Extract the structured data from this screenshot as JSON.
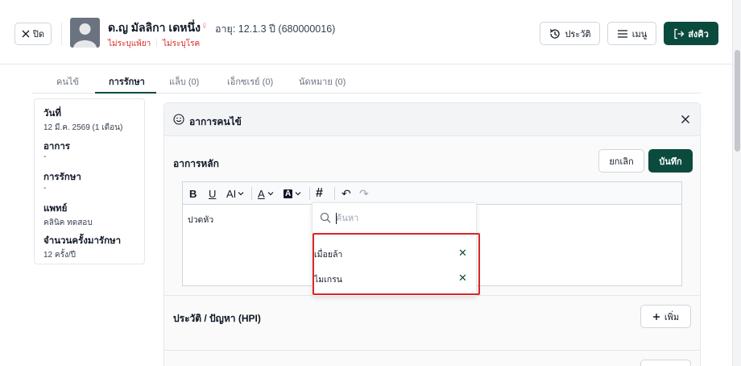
{
  "header": {
    "close_label": "ปิด",
    "patient_name": "ด.ญ มัลลิกา เดหนึ่ง",
    "gender_icon": "female-icon",
    "age_hn": "อายุ: 12.1.3 ปี  (680000016)",
    "allergy_tag": "ไม่ระบุแพ้ยา",
    "disease_tag": "ไม่ระบุโรค",
    "history_label": "ประวัติ",
    "menu_label": "เมนู",
    "send_label": "ส่งคิว"
  },
  "tabs": [
    {
      "label": "คนไข้"
    },
    {
      "label": "การรักษา"
    },
    {
      "label": "แล็บ (0)"
    },
    {
      "label": "เอ็กซเรย์ (0)"
    },
    {
      "label": "นัดหมาย (0)"
    }
  ],
  "summary": {
    "date_label": "วันที่",
    "date_value": "12 มี.ค. 2569 (1 เดือน)",
    "symptom_label": "อาการ",
    "symptom_value": "-",
    "treatment_label": "การรักษา",
    "treatment_value": "-",
    "doctor_label": "แพทย์",
    "doctor_value": "คลินิค ทดสอบ",
    "count_label": "จำนวนครั้งมารักษา",
    "count_value": "12 ครั้ง/ปี"
  },
  "panel": {
    "title": "อาการคนไข้",
    "chief_complaint_label": "อาการหลัก",
    "cancel_label": "ยกเลิก",
    "save_label": "บันทึก",
    "editor_text": "ปวดหัว",
    "hpi_label": "ประวัติ / ปัญหา (HPI)",
    "add_label": "เพิ่ม"
  },
  "toolbar": {
    "bold": "B",
    "underline": "U",
    "font_size": "AI",
    "text_color": "A",
    "highlight": "A",
    "hashtag": "#",
    "undo": "↶",
    "redo": "↷"
  },
  "dropdown": {
    "search_placeholder": "ค้นหา",
    "items": [
      {
        "label": "เมื่อยล้า"
      },
      {
        "label": "ไมเกรน"
      }
    ]
  }
}
